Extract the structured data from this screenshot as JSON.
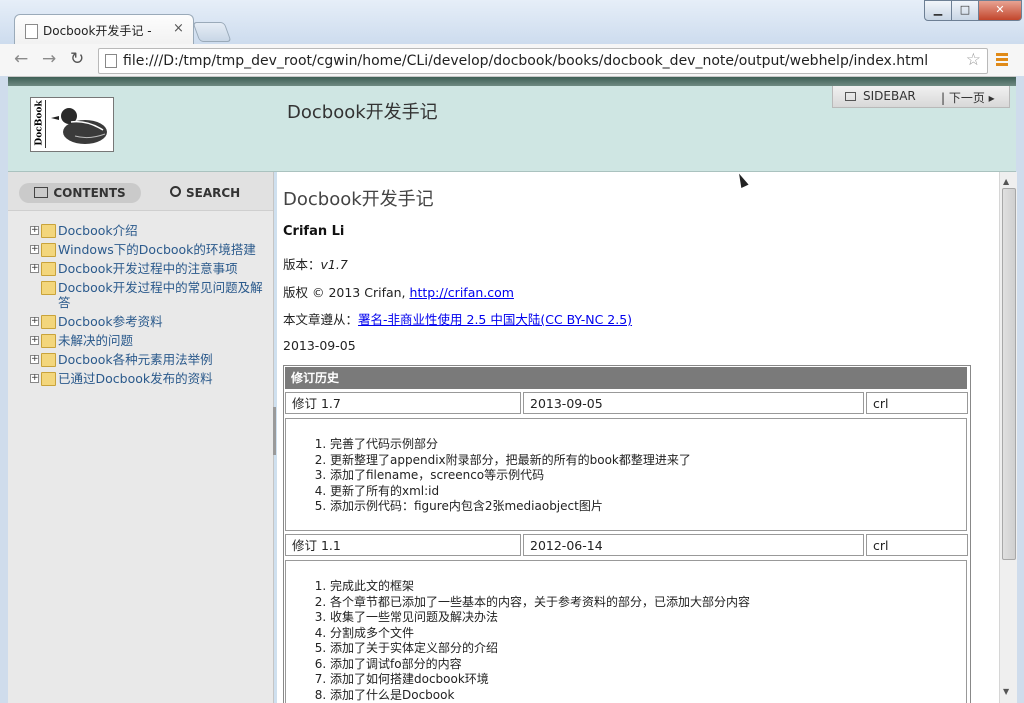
{
  "browser": {
    "tab_title": "Docbook开发手记 -",
    "tab_close": "×",
    "url": "file:///D:/tmp/tmp_dev_root/cgwin/home/CLi/develop/docbook/books/docbook_dev_note/output/webhelp/index.html",
    "back_icon": "←",
    "forward_icon": "→",
    "reload_icon": "↻",
    "star_icon": "☆",
    "min": "▁",
    "max": "□",
    "close": "✕"
  },
  "header": {
    "title": "Docbook开发手记",
    "logo_text": "DocBook",
    "sidebar_label": "SIDEBAR",
    "next_label": "| 下一页 ▸"
  },
  "sidebar": {
    "tab_contents": "CONTENTS",
    "tab_search": "SEARCH",
    "items": [
      {
        "label": "Docbook介绍",
        "expandable": true
      },
      {
        "label": "Windows下的Docbook的环境搭建",
        "expandable": true
      },
      {
        "label": "Docbook开发过程中的注意事项",
        "expandable": true
      },
      {
        "label": "Docbook开发过程中的常见问题及解答",
        "expandable": false
      },
      {
        "label": "Docbook参考资料",
        "expandable": true
      },
      {
        "label": "未解决的问题",
        "expandable": true
      },
      {
        "label": "Docbook各种元素用法举例",
        "expandable": true
      },
      {
        "label": "已通过Docbook发布的资料",
        "expandable": true
      }
    ]
  },
  "content": {
    "title": "Docbook开发手记",
    "author": "Crifan Li",
    "version_label": "版本：",
    "version": "v1.7",
    "copyright_prefix": "版权 © 2013 Crifan, ",
    "copyright_link": "http://crifan.com",
    "license_prefix": "本文章遵从：",
    "license_link": "署名-非商业性使用 2.5 中国大陆(CC BY-NC 2.5)",
    "date": "2013-09-05",
    "revision": {
      "heading": "修订历史",
      "entries": [
        {
          "rev": "修订 1.7",
          "date": "2013-09-05",
          "author": "crl",
          "items": [
            "完善了代码示例部分",
            "更新整理了appendix附录部分，把最新的所有的book都整理进来了",
            "添加了filename，screenco等示例代码",
            "更新了所有的xml:id",
            "添加示例代码：figure内包含2张mediaobject图片"
          ]
        },
        {
          "rev": "修订 1.1",
          "date": "2012-06-14",
          "author": "crl",
          "items": [
            "完成此文的框架",
            "各个章节都已添加了一些基本的内容，关于参考资料的部分，已添加大部分内容",
            "收集了一些常见问题及解决办法",
            "分割成多个文件",
            "添加了关于实体定义部分的介绍",
            "添加了调试fo部分的内容",
            "添加了如何搭建docbook环境",
            "添加了什么是Docbook"
          ]
        }
      ]
    }
  }
}
